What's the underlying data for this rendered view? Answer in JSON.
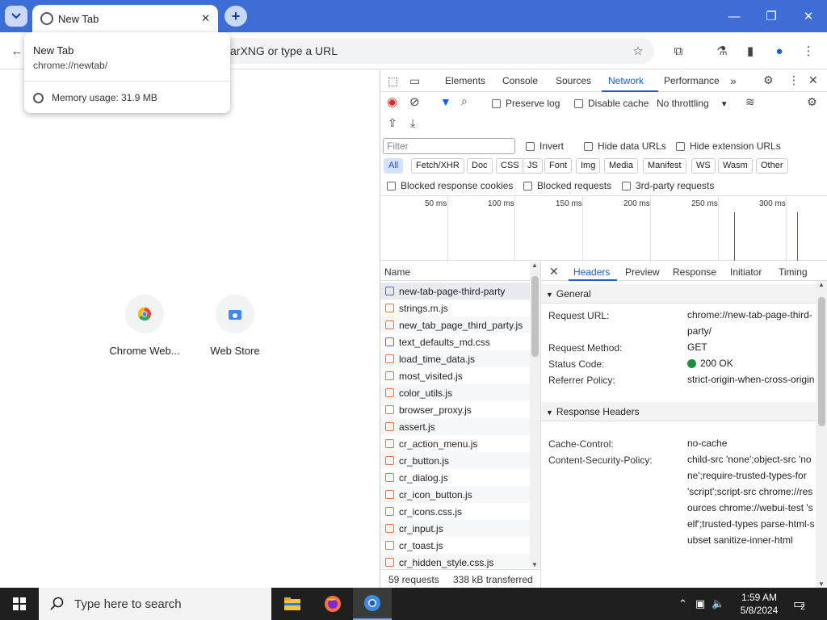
{
  "browser": {
    "tab_title": "New Tab",
    "omnibox_text": "arXNG or type a URL",
    "hovercard": {
      "title": "New Tab",
      "url": "chrome://newtab/",
      "memory": "Memory usage: 31.9 MB"
    }
  },
  "ntp": {
    "shortcuts": [
      {
        "label": "Chrome Web..."
      },
      {
        "label": "Web Store"
      }
    ]
  },
  "devtools": {
    "tabs": [
      "Elements",
      "Console",
      "Sources",
      "Network",
      "Performance"
    ],
    "active_tab": "Network",
    "toolbar": {
      "preserve_log": "Preserve log",
      "disable_cache": "Disable cache",
      "throttling": "No throttling"
    },
    "filter": {
      "placeholder": "Filter",
      "invert": "Invert",
      "hide_data_urls": "Hide data URLs",
      "hide_extension_urls": "Hide extension URLs",
      "chips": [
        "All",
        "Fetch/XHR",
        "Doc",
        "CSS",
        "JS",
        "Font",
        "Img",
        "Media",
        "Manifest",
        "WS",
        "Wasm",
        "Other"
      ],
      "active_chip": "All",
      "blocked_cookies": "Blocked response cookies",
      "blocked_requests": "Blocked requests",
      "third_party": "3rd-party requests"
    },
    "timeline": {
      "ticks": [
        "50 ms",
        "100 ms",
        "150 ms",
        "200 ms",
        "250 ms",
        "300 ms"
      ]
    },
    "list": {
      "name_header": "Name",
      "requests": [
        {
          "name": "new-tab-page-third-party",
          "type": "doc"
        },
        {
          "name": "strings.m.js",
          "type": "js"
        },
        {
          "name": "new_tab_page_third_party.js",
          "type": "js"
        },
        {
          "name": "text_defaults_md.css",
          "type": "css"
        },
        {
          "name": "load_time_data.js",
          "type": "js"
        },
        {
          "name": "most_visited.js",
          "type": "js"
        },
        {
          "name": "color_utils.js",
          "type": "js"
        },
        {
          "name": "browser_proxy.js",
          "type": "js"
        },
        {
          "name": "assert.js",
          "type": "js"
        },
        {
          "name": "cr_action_menu.js",
          "type": "js"
        },
        {
          "name": "cr_button.js",
          "type": "js"
        },
        {
          "name": "cr_dialog.js",
          "type": "js"
        },
        {
          "name": "cr_icon_button.js",
          "type": "js"
        },
        {
          "name": "cr_icons.css.js",
          "type": "js"
        },
        {
          "name": "cr_input.js",
          "type": "js"
        },
        {
          "name": "cr_toast.js",
          "type": "js"
        },
        {
          "name": "cr_hidden_style.css.js",
          "type": "js"
        }
      ],
      "summary_requests": "59 requests",
      "summary_transferred": "338 kB transferred"
    },
    "headers_pane": {
      "tabs": [
        "Headers",
        "Preview",
        "Response",
        "Initiator",
        "Timing"
      ],
      "active_tab": "Headers",
      "general_title": "General",
      "general": [
        {
          "key": "Request URL:",
          "value": "chrome://new-tab-page-third-party/"
        },
        {
          "key": "Request Method:",
          "value": "GET"
        },
        {
          "key": "Status Code:",
          "value": "200 OK"
        },
        {
          "key": "Referrer Policy:",
          "value": "strict-origin-when-cross-origin"
        }
      ],
      "response_title": "Response Headers",
      "response": [
        {
          "key": "Cache-Control:",
          "value": "no-cache"
        },
        {
          "key": "Content-Security-Policy:",
          "value": "child-src 'none';object-src 'none';require-trusted-types-for 'script';script-src chrome://resources chrome://webui-test 'self';trusted-types parse-html-subset sanitize-inner-html"
        }
      ]
    }
  },
  "taskbar": {
    "search_placeholder": "Type here to search",
    "time": "1:59 AM",
    "date": "5/8/2024",
    "notification_count": "2"
  },
  "colors": {
    "titlebar": "#3c6ed6",
    "accent": "#1a5fd0",
    "record_red": "#d93025",
    "status_green": "#1e8e3e"
  }
}
